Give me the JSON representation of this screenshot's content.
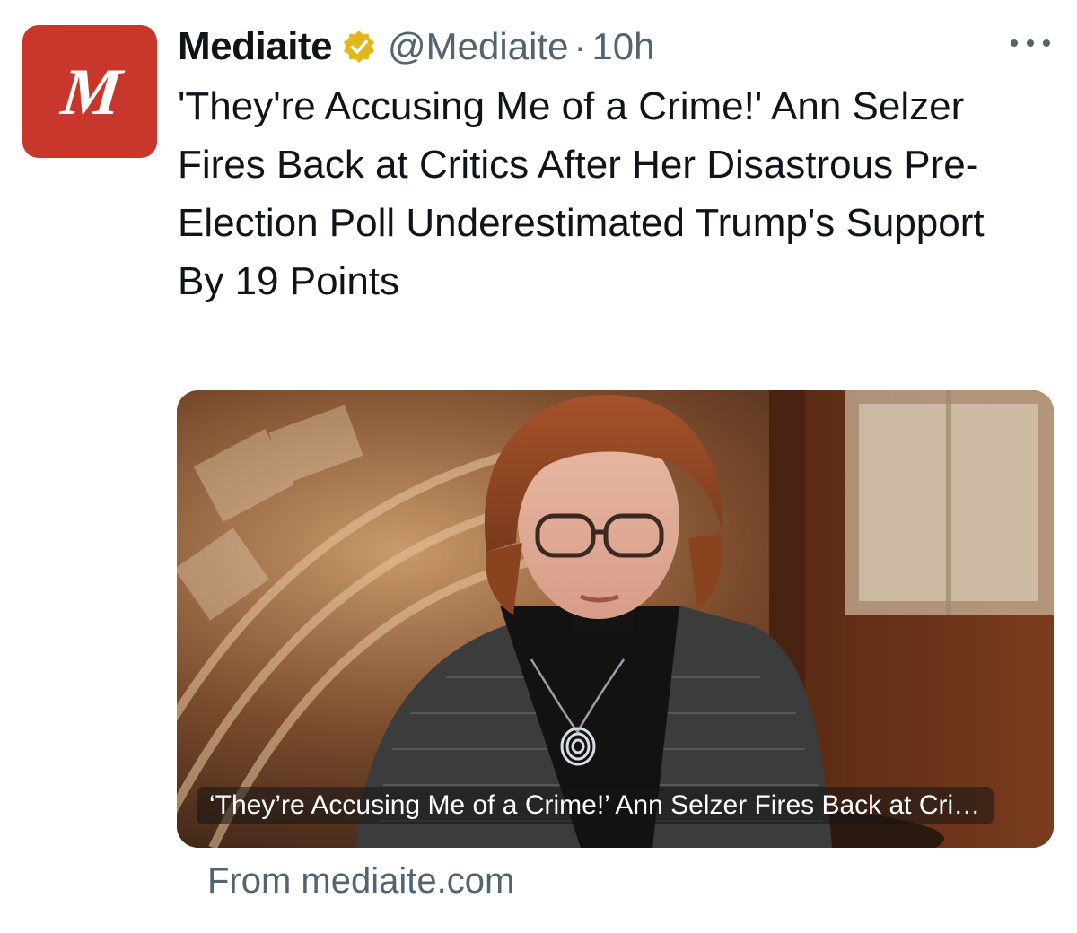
{
  "account": {
    "avatar_letter": "M",
    "name": "Mediaite",
    "handle": "@Mediaite",
    "separator": "·",
    "time": "10h",
    "avatar_color": "#c9372c",
    "verified_icon": "verified-badge-icon"
  },
  "tweet": {
    "text": "'They're Accusing Me of a Crime!' Ann Selzer Fires Back at Critics After Her Disastrous Pre-Election Poll Underestimated Trump's Support By 19 Points"
  },
  "card": {
    "caption": "‘They’re Accusing Me of a Crime!’ Ann Selzer Fires Back at Critics After Her Disastrous Pre-Election Poll Underestimated Trump's Support By 19 Points",
    "source": "From mediaite.com"
  },
  "colors": {
    "text": "#0f1419",
    "secondary": "#536471",
    "badge": "#e2b719"
  }
}
